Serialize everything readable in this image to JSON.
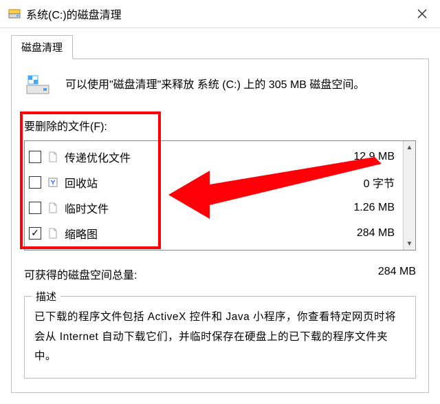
{
  "title": "系统(C:)的磁盘清理",
  "tab_label": "磁盘清理",
  "intro": "可以使用\"磁盘清理\"来释放 系统 (C:) 上的 305 MB 磁盘空间。",
  "files_label": "要删除的文件(F):",
  "rows": [
    {
      "name": "传递优化文件",
      "size": "12.9 MB",
      "checked": false,
      "icon": "doc"
    },
    {
      "name": "回收站",
      "size": "0 字节",
      "checked": false,
      "icon": "recycle"
    },
    {
      "name": "临时文件",
      "size": "1.26 MB",
      "checked": false,
      "icon": "doc"
    },
    {
      "name": "缩略图",
      "size": "284 MB",
      "checked": true,
      "icon": "doc"
    }
  ],
  "total_label": "可获得的磁盘空间总量:",
  "total_value": "284 MB",
  "desc_label": "描述",
  "desc_body": "已下载的程序文件包括 ActiveX 控件和 Java 小程序，你查看特定网页时将会从 Internet 自动下载它们，并临时保存在硬盘上的已下载的程序文件夹中。"
}
